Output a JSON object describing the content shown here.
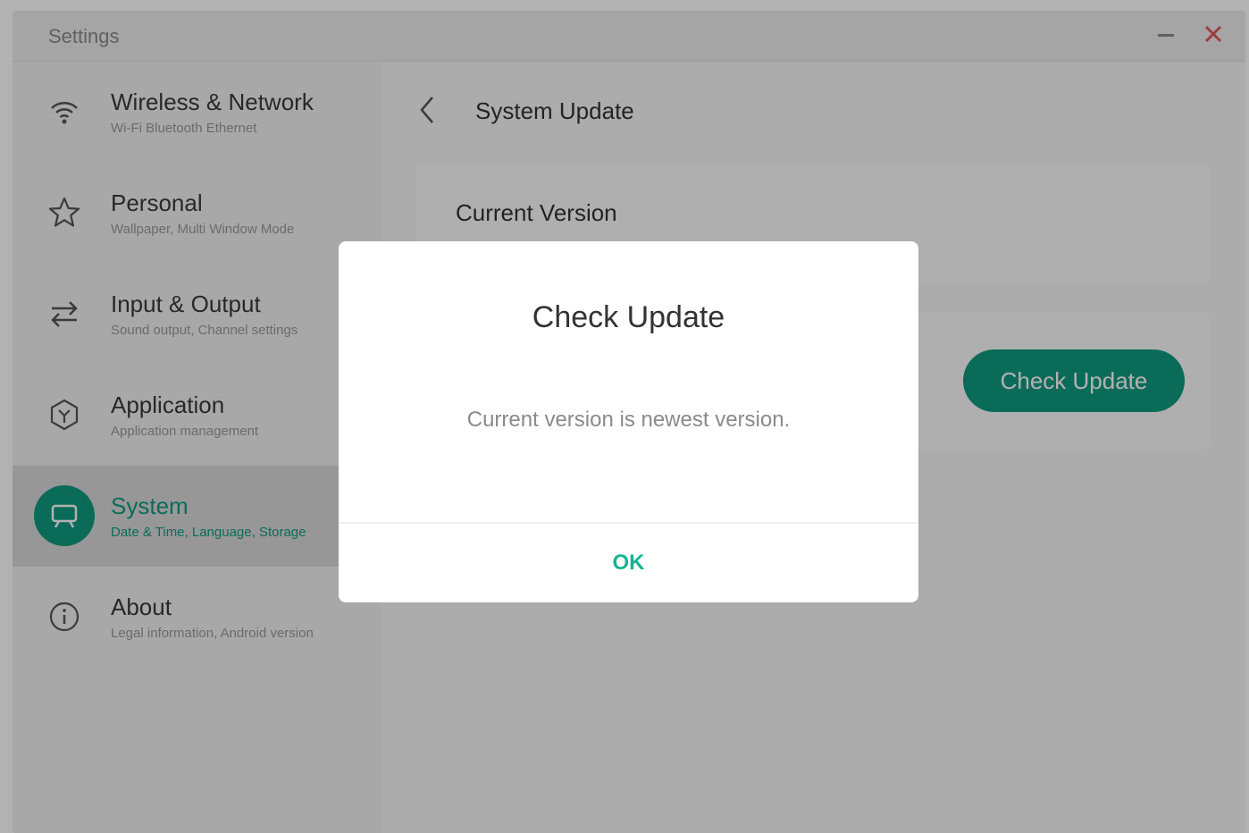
{
  "window": {
    "title": "Settings",
    "minimize_icon": "minimize-icon",
    "close_icon": "close-icon",
    "accent_color": "#119a80",
    "close_color": "#e05a5a"
  },
  "sidebar": {
    "items": [
      {
        "title": "Wireless & Network",
        "subtitle": "Wi-Fi Bluetooth Ethernet",
        "icon": "wifi-icon",
        "active": false
      },
      {
        "title": "Personal",
        "subtitle": "Wallpaper, Multi Window Mode",
        "icon": "star-icon",
        "active": false
      },
      {
        "title": "Input & Output",
        "subtitle": "Sound output, Channel settings",
        "icon": "swap-arrows-icon",
        "active": false
      },
      {
        "title": "Application",
        "subtitle": "Application management",
        "icon": "application-icon",
        "active": false
      },
      {
        "title": "System",
        "subtitle": "Date & Time, Language, Storage",
        "icon": "presentation-board-icon",
        "active": true
      },
      {
        "title": "About",
        "subtitle": "Legal information, Android version",
        "icon": "info-icon",
        "active": false
      }
    ]
  },
  "main": {
    "header": {
      "back_icon": "chevron-left-icon",
      "title": "System Update"
    },
    "current_version": {
      "label": "Current Version",
      "value": ""
    },
    "check_update_button": "Check Update"
  },
  "dialog": {
    "title": "Check Update",
    "message": "Current version is newest version.",
    "ok_label": "OK"
  }
}
